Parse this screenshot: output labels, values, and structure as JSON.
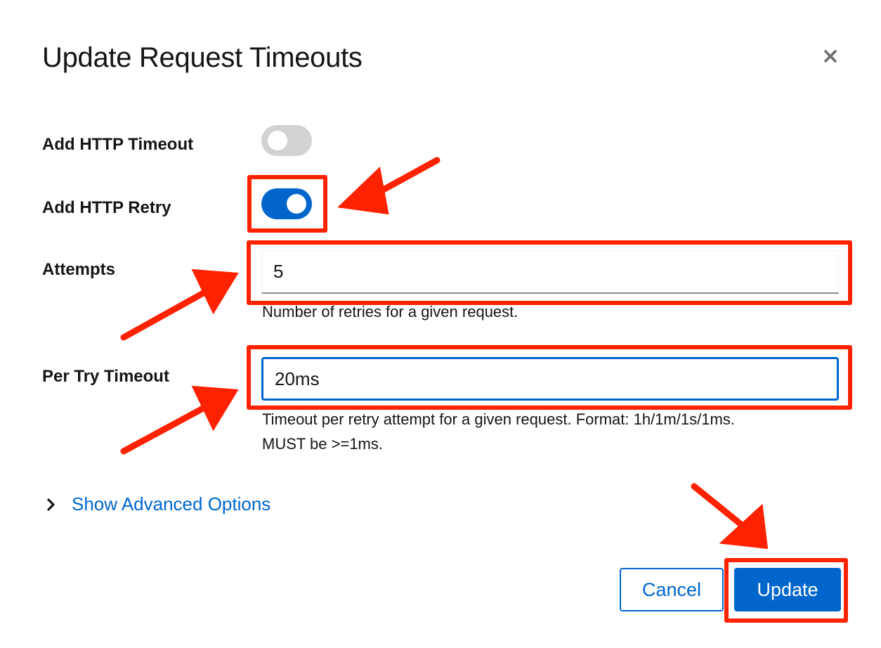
{
  "modal": {
    "title": "Update Request Timeouts",
    "close_icon": "close-icon"
  },
  "form": {
    "http_timeout": {
      "label": "Add HTTP Timeout",
      "enabled": false
    },
    "http_retry": {
      "label": "Add HTTP Retry",
      "enabled": true
    },
    "attempts": {
      "label": "Attempts",
      "value": "5",
      "helper": "Number of retries for a given request."
    },
    "per_try_timeout": {
      "label": "Per Try Timeout",
      "value": "20ms",
      "helper_line1": "Timeout per retry attempt for a given request. Format: 1h/1m/1s/1ms.",
      "helper_line2": "MUST be >=1ms."
    },
    "advanced": {
      "label": "Show Advanced Options",
      "icon": "chevron-right-icon"
    }
  },
  "footer": {
    "cancel_label": "Cancel",
    "update_label": "Update"
  },
  "colors": {
    "primary": "#0066cc",
    "annotation": "#ff2200",
    "switch_off": "#d2d2d2"
  }
}
